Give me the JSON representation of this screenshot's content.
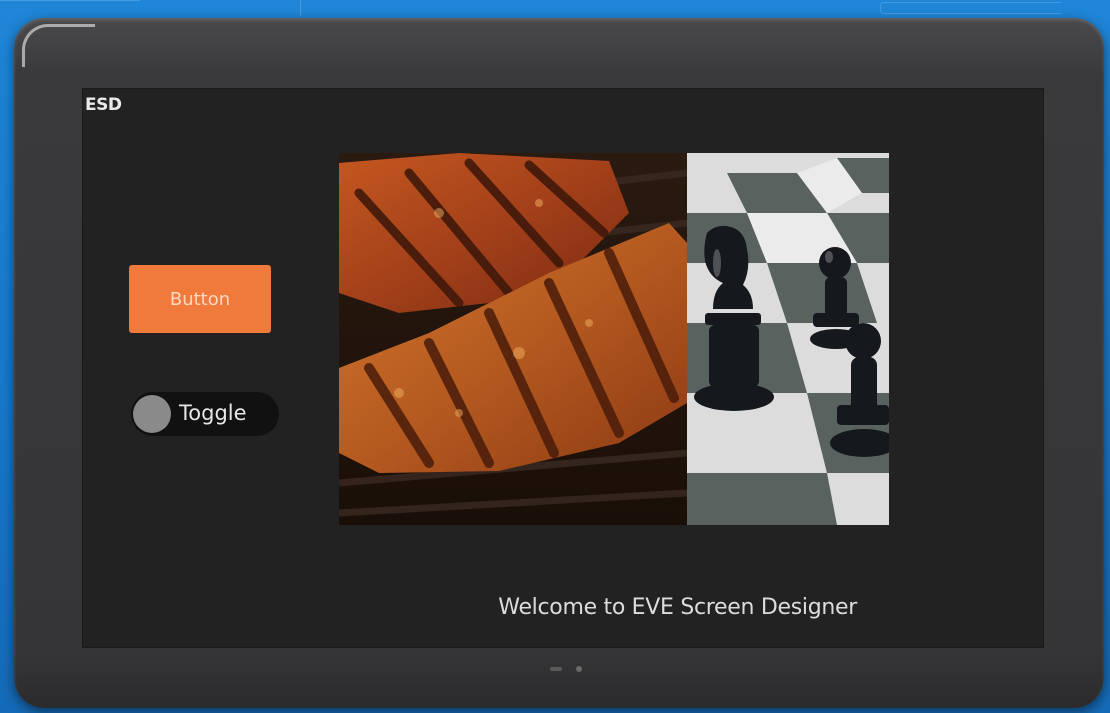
{
  "screen": {
    "logo_text": "ESD",
    "button_label": "Button",
    "toggle": {
      "label": "Toggle",
      "state": "off"
    },
    "welcome_text": "Welcome to EVE Screen Designer",
    "images": [
      {
        "name": "grilled-meat"
      },
      {
        "name": "chess-pieces"
      }
    ],
    "page_indicator": {
      "pages": 2,
      "current": 1
    }
  },
  "colors": {
    "background": "#1f7fd0",
    "bezel": "#3a3a3c",
    "screen": "#222222",
    "button": "#f07a3c",
    "toggle_track": "#111111",
    "toggle_knob": "#8a8a8a"
  }
}
